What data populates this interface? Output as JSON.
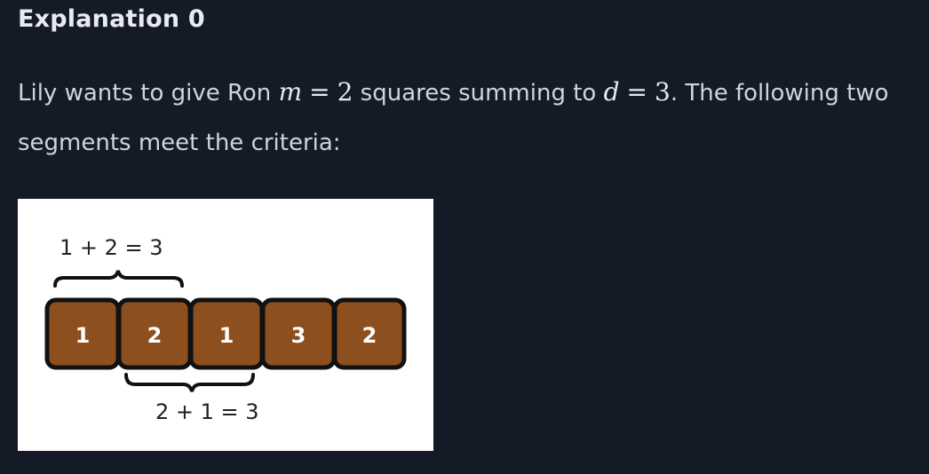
{
  "heading": "Explanation 0",
  "paragraph": {
    "text1": "Lily wants to give Ron ",
    "m_var": "m",
    "eq1": "=",
    "m_val": "2",
    "text2": " squares summing to ",
    "d_var": "d",
    "eq2": "=",
    "d_val": "3",
    "text3": ". The following two segments meet the criteria:"
  },
  "figure": {
    "squares": [
      "1",
      "2",
      "1",
      "3",
      "2"
    ],
    "top_label": "1 + 2 = 3",
    "bottom_label": "2 + 1 = 3",
    "colors": {
      "square_fill": "#8d4f1e",
      "square_border": "#111111",
      "background": "#ffffff"
    }
  },
  "colors": {
    "page_background": "#151a27",
    "text": "#cfd4dd",
    "heading": "#e8ebf1"
  }
}
